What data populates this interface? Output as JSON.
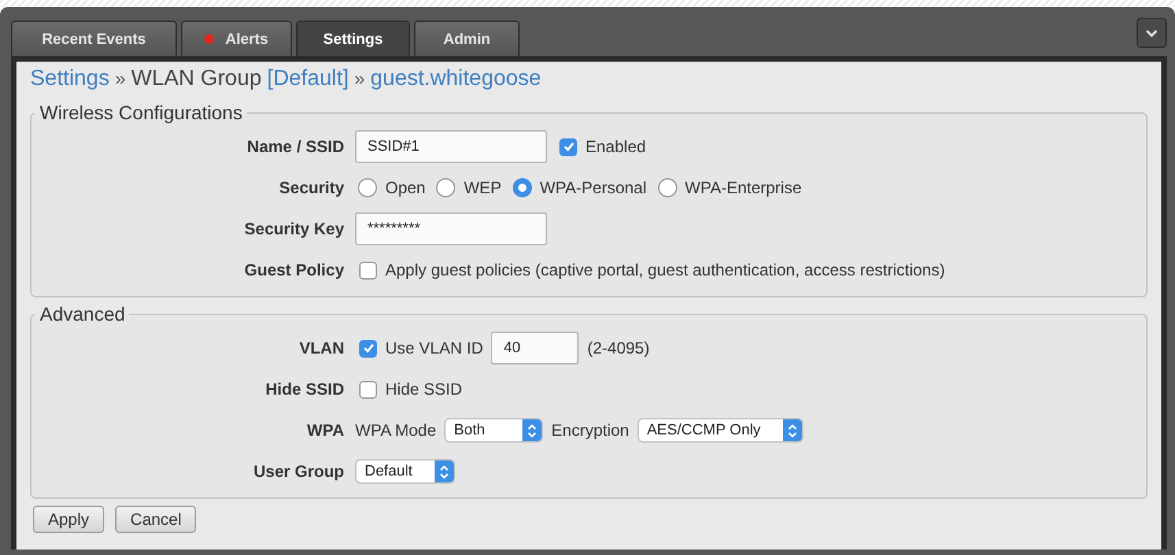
{
  "tabs": [
    {
      "label": "Recent Events",
      "selected": false,
      "alert": false
    },
    {
      "label": "Alerts",
      "selected": false,
      "alert": true
    },
    {
      "label": "Settings",
      "selected": true,
      "alert": false
    },
    {
      "label": "Admin",
      "selected": false,
      "alert": false
    }
  ],
  "breadcrumb": [
    {
      "text": "Settings",
      "kind": "link"
    },
    {
      "text": "»",
      "kind": "separator"
    },
    {
      "text": "WLAN Group",
      "kind": "plain"
    },
    {
      "text": "[Default]",
      "kind": "link"
    },
    {
      "text": "»",
      "kind": "separator"
    },
    {
      "text": "guest.whitegoose",
      "kind": "link"
    }
  ],
  "sections": [
    {
      "title": "Wireless Configurations",
      "rows": [
        {
          "label": "Name / SSID",
          "kind": "text_checkbox",
          "value": "SSID#1",
          "checkbox": {
            "label": "Enabled",
            "checked": true
          }
        },
        {
          "label": "Security",
          "kind": "radio",
          "options": [
            {
              "label": "Open",
              "selected": false
            },
            {
              "label": "WEP",
              "selected": false
            },
            {
              "label": "WPA-Personal",
              "selected": true
            },
            {
              "label": "WPA-Enterprise",
              "selected": false
            }
          ]
        },
        {
          "label": "Security Key",
          "kind": "password",
          "value": "*********"
        },
        {
          "label": "Guest Policy",
          "kind": "checkbox",
          "checkbox": {
            "label": "Apply guest policies (captive portal, guest authentication, access restrictions)",
            "checked": false
          }
        }
      ]
    },
    {
      "title": "Advanced",
      "rows": [
        {
          "label": "VLAN",
          "kind": "checkbox_input",
          "checkbox": {
            "label": "Use VLAN ID",
            "checked": true
          },
          "value": "40",
          "hint": "(2-4095)"
        },
        {
          "label": "Hide SSID",
          "kind": "checkbox",
          "checkbox": {
            "label": "Hide SSID",
            "checked": false
          }
        },
        {
          "label": "WPA",
          "kind": "selects",
          "selects": [
            {
              "label": "WPA Mode",
              "value": "Both"
            },
            {
              "label": "Encryption",
              "value": "AES/CCMP Only"
            }
          ]
        },
        {
          "label": "User Group",
          "kind": "selects",
          "selects": [
            {
              "value": "Default"
            }
          ]
        }
      ]
    }
  ],
  "buttons": [
    "Apply",
    "Cancel"
  ]
}
